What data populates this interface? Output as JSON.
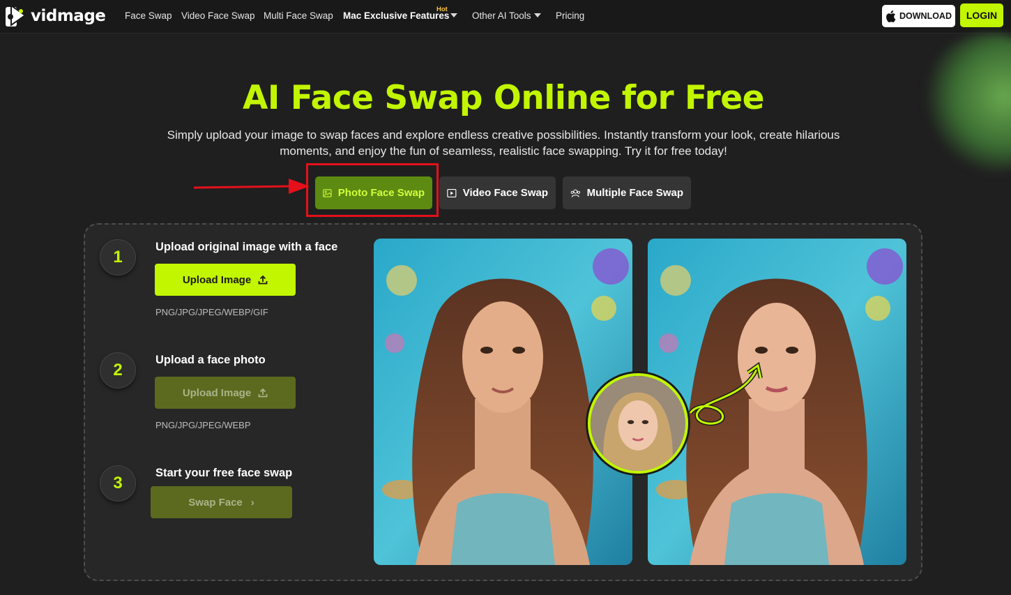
{
  "nav": {
    "logo_text": "vidmage",
    "links": [
      "Face Swap",
      "Video Face Swap",
      "Multi Face Swap"
    ],
    "mac_label": "Mac Exclusive Features",
    "hot_badge": "Hot",
    "other_tools": "Other AI Tools",
    "pricing": "Pricing",
    "download_label": "DOWNLOAD",
    "login_label": "LOGIN"
  },
  "hero": {
    "title": "AI Face Swap Online for Free",
    "description": "Simply upload your image to swap faces and explore endless creative possibilities. Instantly transform your look, create hilarious moments, and enjoy the fun of seamless, realistic face swapping. Try it for free today!"
  },
  "tabs": [
    {
      "label": "Photo Face Swap",
      "icon": "image-icon",
      "active": true
    },
    {
      "label": "Video Face Swap",
      "icon": "video-play-icon",
      "active": false
    },
    {
      "label": "Multiple Face Swap",
      "icon": "users-icon",
      "active": false
    }
  ],
  "steps": [
    {
      "number": "1",
      "title": "Upload original image with a face",
      "button": "Upload Image",
      "formats": "PNG/JPG/JPEG/WEBP/GIF"
    },
    {
      "number": "2",
      "title": "Upload a face photo",
      "button": "Upload Image",
      "formats": "PNG/JPG/JPEG/WEBP"
    },
    {
      "number": "3",
      "title": "Start your free face swap",
      "button": "Swap Face",
      "button_icon": "›"
    }
  ],
  "colors": {
    "accent": "#c2f500",
    "active_tab_bg": "#5d8b12",
    "disabled_button_bg": "#5b6a1e",
    "highlight_red": "#e5101b",
    "background": "#1f1f1f"
  }
}
